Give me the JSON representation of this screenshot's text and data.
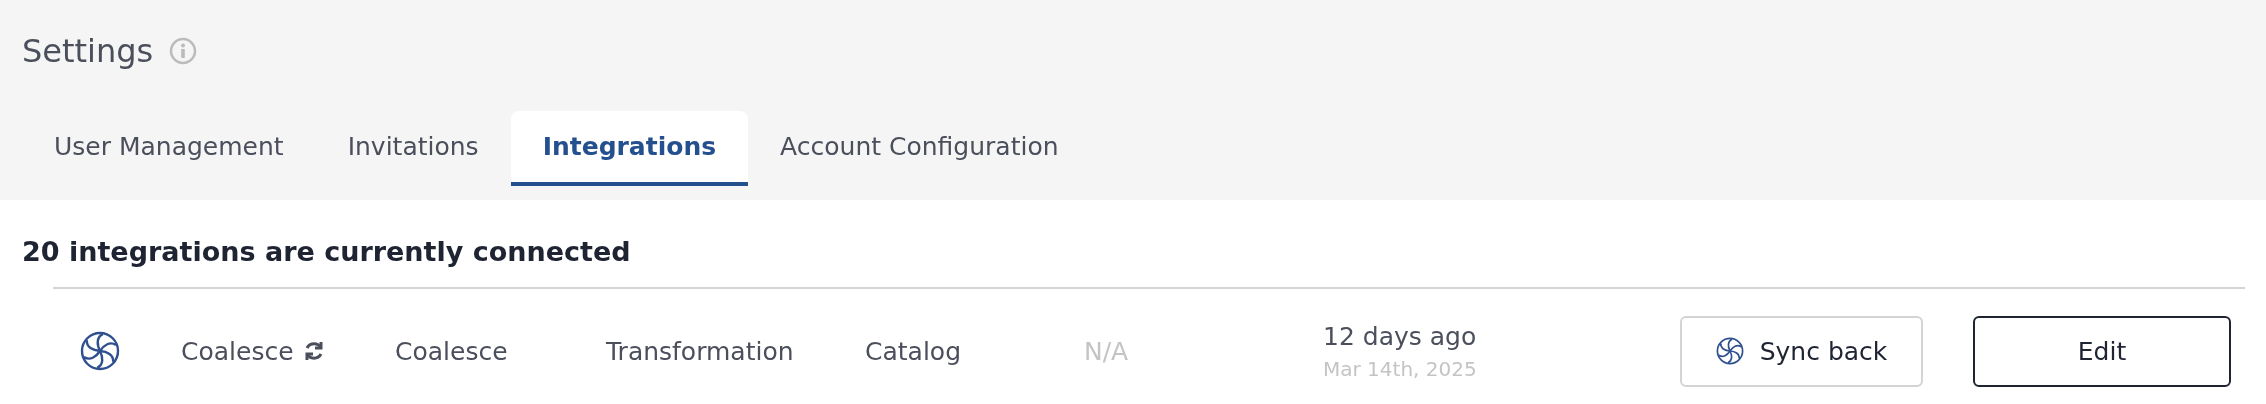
{
  "page": {
    "title": "Settings"
  },
  "tabs": [
    {
      "label": "User Management",
      "selected": false
    },
    {
      "label": "Invitations",
      "selected": false
    },
    {
      "label": "Integrations",
      "selected": true
    },
    {
      "label": "Account Configuration",
      "selected": false
    }
  ],
  "summary": "20 integrations are currently connected",
  "integrations": [
    {
      "name": "Coalesce",
      "syncing": true,
      "provider": "Coalesce",
      "category": "Transformation",
      "type": "Catalog",
      "column_5": "N/A",
      "last_sync": "12 days ago",
      "last_sync_date": "Mar 14th, 2025",
      "sync_button": "Sync back",
      "edit_button": "Edit"
    }
  ]
}
